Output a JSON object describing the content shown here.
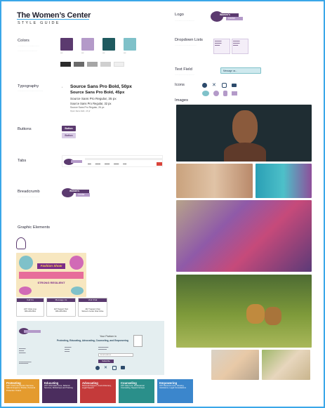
{
  "header": {
    "title": "The Women’s Center",
    "subtitle": "STYLE GUIDE"
  },
  "sections": {
    "colors": "Colors",
    "typography": "Typography",
    "buttons": "Buttons",
    "tabs": "Tabs",
    "breadcrumb": "Breadcrumb",
    "graphic_elements": "Graphic Elements",
    "logo": "Logo",
    "dropdown_lists": "Dropdown Lists",
    "text_field": "Text Field",
    "icons": "Icons",
    "images": "Images"
  },
  "colors": {
    "primary": [
      "#5b3a6f",
      "#b49ac9",
      "#1f5a5f",
      "#7fc1c9"
    ],
    "grays": [
      "#2b2b2b",
      "#6b6b6b",
      "#a6a6a6",
      "#d0d0d0",
      "#efefef"
    ],
    "accent": "#3aa7e8"
  },
  "typography": {
    "h1": "Source Sans Pro Bold, 50px",
    "h2": "Source Sans Pro Bold, 45px",
    "p1": "Source Sans Pro Regular, 35 px",
    "p2": "Source Sans Pro Regular, 32 px",
    "p3": "Source Sans Pro Regular, 26 px",
    "p4": "Open Sans Italic, 14 pt"
  },
  "buttons": {
    "primary": "Button",
    "secondary": "Button"
  },
  "logo": {
    "line1": "Women’s",
    "line2": "Center"
  },
  "text_field": {
    "placeholder": "Message us..."
  },
  "icons": [
    "facebook-icon",
    "x-icon",
    "instagram-icon",
    "youtube-icon",
    "chat-icon",
    "speech-icon",
    "phone-icon",
    "email-icon"
  ],
  "flyer": {
    "heading": "Fashion Show",
    "subheading": "STRONG RESILIENT"
  },
  "contact_cards": [
    {
      "label": "Call Us",
      "line1": "24/7 Crisis Line",
      "line2": "906-226-6611"
    },
    {
      "label": "Message Us",
      "line1": "24/7 Support Text",
      "line2": "906-226-6611"
    },
    {
      "label": "Visit Chat",
      "line1": "24/7 Support Chat",
      "line2": "Women’s Center Chat Online"
    }
  ],
  "footer": {
    "headline": "Your Partner in",
    "body": "Protecting, Educating, Advocating, Counseling, and Empowering",
    "subscribe": "Subscribe",
    "email_placeholder": "Email address"
  },
  "services": [
    {
      "title": "Protecting",
      "color": "#e49b2e",
      "text": "24/7 Crisis Intervention Services, Safe Emergency Shelter, Personal Protection Orders"
    },
    {
      "title": "Educating",
      "color": "#4b2d5e",
      "text": "24/7 Information Line, Referral Services, Workshops and Training"
    },
    {
      "title": "Advocating",
      "color": "#c43a3a",
      "text": "Personal Support, Court Advocacy, Legal Support"
    },
    {
      "title": "Counseling",
      "color": "#2a8f8a",
      "text": "24/7 Help Line, Professional Counseling, Support Groups"
    },
    {
      "title": "Empowering",
      "color": "#3b86cc",
      "text": "24/7 Resource Line, Housing Assistance, Legal Consultations"
    }
  ]
}
